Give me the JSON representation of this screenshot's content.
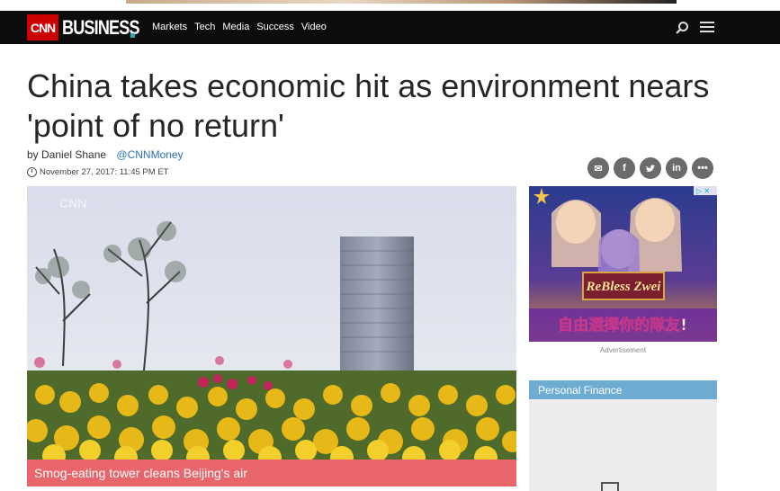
{
  "nav": {
    "logo_cnn": "CNN",
    "logo_business": "BUSINESS",
    "links": [
      "Markets",
      "Tech",
      "Media",
      "Success",
      "Video"
    ]
  },
  "article": {
    "headline": "China takes economic hit as environment nears 'point of no return'",
    "author": "by Daniel Shane",
    "handle": "@CNNMoney",
    "date": "November 27, 2017: 11:45 PM ET"
  },
  "share_icons": [
    "email-icon",
    "facebook-icon",
    "twitter-icon",
    "linkedin-icon",
    "more-icon"
  ],
  "video": {
    "caption": "Smog-eating tower cleans Beijing's air",
    "watermark": "CNN"
  },
  "ad": {
    "title": "ReBless Zwei",
    "subtitle": "自由選擇你的隊友!",
    "label": "Advertisement"
  },
  "sidebar": {
    "section_title": "Personal Finance"
  },
  "colors": {
    "nav_bg": "#0c0c0c",
    "cnn_red": "#cc0000",
    "caption_bg": "#e9656c",
    "section_bg": "#6eacd2",
    "link": "#2c72b8"
  }
}
